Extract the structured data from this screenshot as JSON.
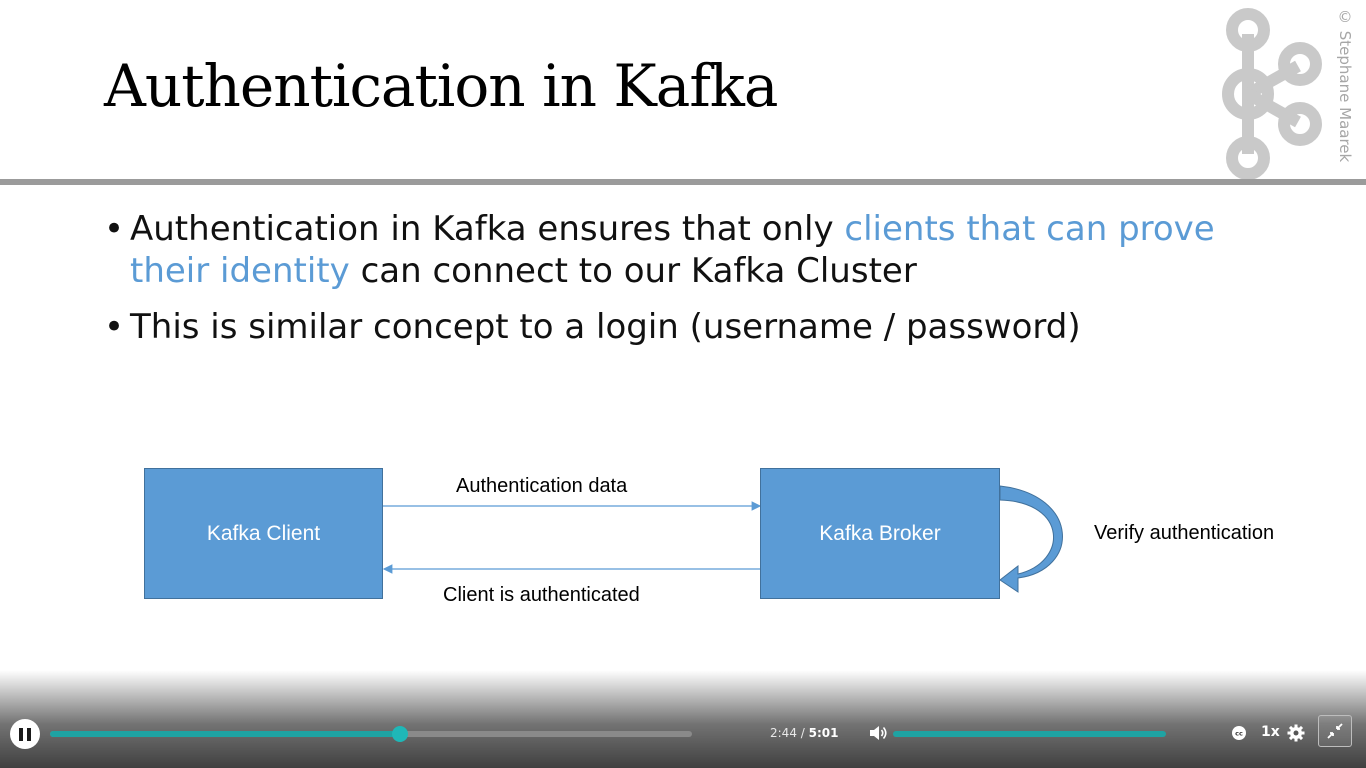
{
  "slide": {
    "title": "Authentication in Kafka",
    "copyright": "© Stephane Maarek",
    "bullets": [
      {
        "before": "Authentication in Kafka ensures that only ",
        "highlight": "clients that can prove their identity",
        "after": " can connect to our Kafka Cluster"
      },
      {
        "before": "This is similar concept to a login (username / password)"
      }
    ],
    "diagram": {
      "client_label": "Kafka Client",
      "broker_label": "Kafka Broker",
      "request_label": "Authentication data",
      "response_label": "Client is authenticated",
      "verify_label": "Verify authentication"
    },
    "logo_icon": "kafka-logo-icon",
    "colors": {
      "accent": "#5b9bd5",
      "box_border": "#41719c",
      "rule": "#9b9b9b"
    }
  },
  "player": {
    "current_time": "2:44",
    "separator": " / ",
    "duration": "5:01",
    "progress_fraction": 0.545,
    "volume_fraction": 1.0,
    "speed": "1x",
    "icons": [
      "pause-icon",
      "volume-icon",
      "closed-captions-icon",
      "gear-icon",
      "exit-fullscreen-icon"
    ],
    "accent_color": "#1fa3a3"
  }
}
